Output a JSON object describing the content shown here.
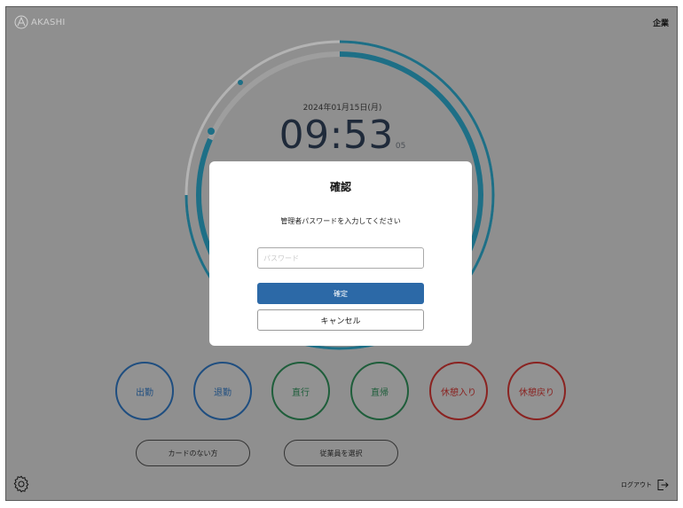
{
  "header": {
    "logo_text": "AKASHI",
    "company": "企業"
  },
  "clock": {
    "date": "2024年01月15日(月)",
    "time": "09:53",
    "seconds": "05"
  },
  "punch_buttons": [
    {
      "label": "出勤",
      "color": "#1f4e80"
    },
    {
      "label": "退勤",
      "color": "#1f4e80"
    },
    {
      "label": "直行",
      "color": "#1f5e3b"
    },
    {
      "label": "直帰",
      "color": "#1f5e3b"
    },
    {
      "label": "休憩入り",
      "color": "#8a2321"
    },
    {
      "label": "休憩戻り",
      "color": "#8a2321"
    }
  ],
  "footer": {
    "no_card_label": "カードのない方",
    "select_employee_label": "従業員を選択",
    "logout_label": "ログアウト"
  },
  "modal": {
    "title": "確認",
    "message": "管理者パスワードを入力してください",
    "password_placeholder": "パスワード",
    "password_value": "",
    "confirm_label": "確定",
    "cancel_label": "キャンセル"
  },
  "colors": {
    "accent_blue": "#2c69a7",
    "ring_teal": "#1e6f86",
    "ring_gray": "#b0b0b0",
    "overlay": "#8f8f8f"
  },
  "icons": {
    "logo": "akashi-logo-icon",
    "settings": "gear-icon",
    "logout": "logout-icon"
  }
}
